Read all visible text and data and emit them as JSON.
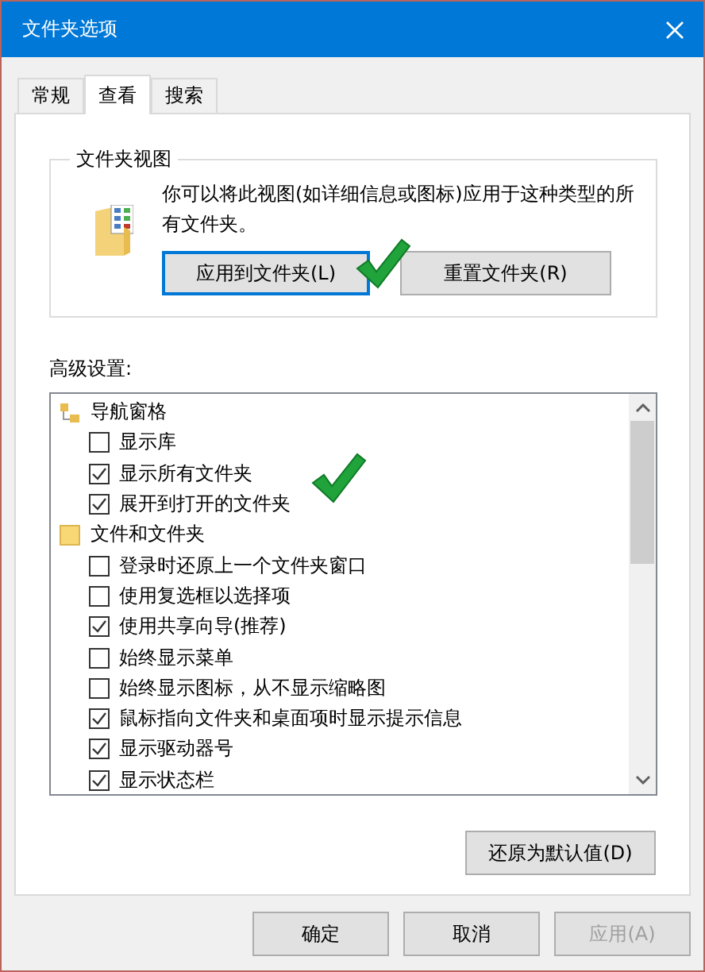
{
  "window": {
    "title": "文件夹选项"
  },
  "tabs": [
    {
      "label": "常规",
      "selected": false
    },
    {
      "label": "查看",
      "selected": true
    },
    {
      "label": "搜索",
      "selected": false
    }
  ],
  "folder_views": {
    "title": "文件夹视图",
    "description": "你可以将此视图(如详细信息或图标)应用于这种类型的所有文件夹。",
    "buttons": [
      {
        "label": "应用到文件夹(L)",
        "selected": true
      },
      {
        "label": "重置文件夹(R)",
        "selected": false
      }
    ]
  },
  "advanced": {
    "label": "高级设置:",
    "tree": [
      {
        "label": "导航窗格",
        "kind": "navigation",
        "children": [
          {
            "label": "显示库",
            "checked": false
          },
          {
            "label": "显示所有文件夹",
            "checked": true
          },
          {
            "label": "展开到打开的文件夹",
            "checked": true
          }
        ]
      },
      {
        "label": "文件和文件夹",
        "kind": "folder",
        "children": [
          {
            "label": "登录时还原上一个文件夹窗口",
            "checked": false
          },
          {
            "label": "使用复选框以选择项",
            "checked": false
          },
          {
            "label": "使用共享向导(推荐)",
            "checked": true
          },
          {
            "label": "始终显示菜单",
            "checked": false
          },
          {
            "label": "始终显示图标，从不显示缩略图",
            "checked": false
          },
          {
            "label": "鼠标指向文件夹和桌面项时显示提示信息",
            "checked": true
          },
          {
            "label": "显示驱动器号",
            "checked": true
          },
          {
            "label": "显示状态栏",
            "checked": true
          }
        ]
      }
    ]
  },
  "restore_button": "还原为默认值(D)",
  "footer_buttons": [
    {
      "label": "确定",
      "disabled": false
    },
    {
      "label": "取消",
      "disabled": false
    },
    {
      "label": "应用(A)",
      "disabled": true
    }
  ]
}
